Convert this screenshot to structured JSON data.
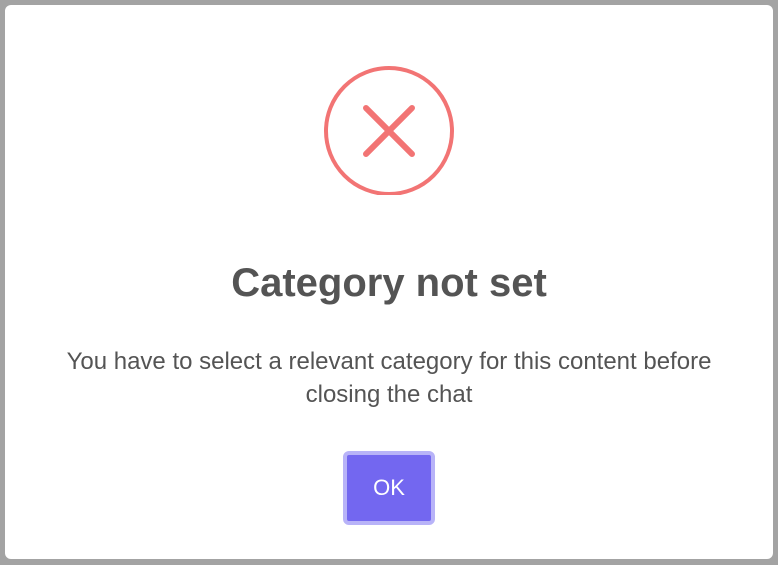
{
  "dialog": {
    "icon": "error-x-circle-icon",
    "icon_color": "#f27474",
    "title": "Category not set",
    "message": "You have to select a relevant category for this content before closing the chat",
    "confirm_label": "OK",
    "confirm_color": "#7367f0"
  }
}
